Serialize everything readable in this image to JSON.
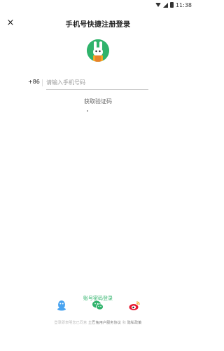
{
  "status_bar": {
    "time": "11:38"
  },
  "header": {
    "title": "手机号快捷注册登录",
    "close_label": "×"
  },
  "phone": {
    "country_code": "+86",
    "placeholder": "请输入手机号码"
  },
  "actions": {
    "get_code": "获取验证码",
    "password_login": "账号密码登录"
  },
  "social": [
    {
      "name": "QQ",
      "icon": "qq-icon",
      "color": "#4aa4f0"
    },
    {
      "name": "WeChat",
      "icon": "wechat-icon",
      "color": "#2fb36b"
    },
    {
      "name": "Weibo",
      "icon": "weibo-icon",
      "color": "#e6162d"
    }
  ],
  "footer": {
    "prefix": "登录即表明您已同意",
    "agreement": "土巴兔用户服务协议",
    "and": "和",
    "privacy": "隐私政策"
  },
  "colors": {
    "accent": "#2fb36b",
    "text": "#222222"
  }
}
